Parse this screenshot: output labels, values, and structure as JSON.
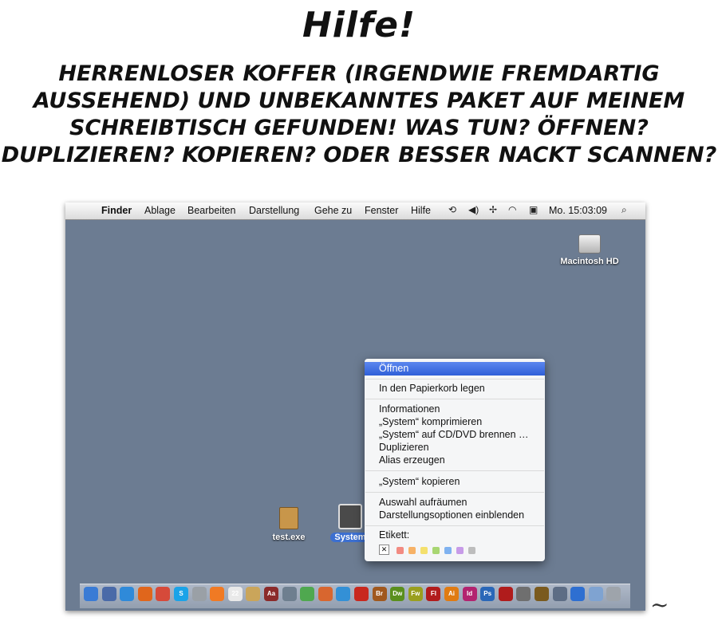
{
  "title": "Hilfe!",
  "message": [
    "Herrenloser KOFFER (irgendwie fremdartig",
    "aussehend) und unbekanntes PAKET auf meinem",
    "Schreibtisch gefunden! Was tun? öffnen?",
    "Duplizieren? Kopieren? Oder besser nackt scannen?"
  ],
  "menubar": {
    "apple_icon": "",
    "items": [
      "Finder",
      "Ablage",
      "Bearbeiten",
      "Darstellung",
      "Gehe zu",
      "Fenster",
      "Hilfe"
    ],
    "status_icons": [
      "time-machine-icon",
      "volume-icon",
      "bluetooth-icon",
      "wifi-icon",
      "clock-icon"
    ],
    "clock": "Mo. 15:03:09",
    "search_icon": "magnifying-glass-icon"
  },
  "desktop": {
    "hd_label": "Macintosh HD",
    "exe_label": "test.exe",
    "system_label": "System"
  },
  "context_menu": {
    "open": "Öffnen",
    "trash": "In den Papierkorb legen",
    "info": "Informationen",
    "compress": "„System“ komprimieren",
    "burn": "„System“ auf CD/DVD brennen …",
    "duplicate": "Duplizieren",
    "alias": "Alias erzeugen",
    "copy": "„System“ kopieren",
    "cleanup": "Auswahl aufräumen",
    "view_options": "Darstellungsoptionen einblenden",
    "label_heading": "Etikett:",
    "label_none": "✕",
    "label_colors": [
      "#f28b82",
      "#f7b267",
      "#f4e06d",
      "#a8d672",
      "#7fb2f0",
      "#c79be8",
      "#bdbdbd"
    ]
  },
  "dock": {
    "apps": [
      {
        "name": "finder-icon",
        "label": "",
        "color": "#3a7bd5"
      },
      {
        "name": "preview-icon",
        "label": "",
        "color": "#4a6aa8"
      },
      {
        "name": "safari-icon",
        "label": "",
        "color": "#2f8ad9"
      },
      {
        "name": "firefox-icon",
        "label": "",
        "color": "#e0661c"
      },
      {
        "name": "chrome-icon",
        "label": "",
        "color": "#d64a3a"
      },
      {
        "name": "skype-icon",
        "label": "S",
        "color": "#1aa3e8"
      },
      {
        "name": "support-icon",
        "label": "",
        "color": "#9aa0a6"
      },
      {
        "name": "xampp-icon",
        "label": "",
        "color": "#f07a24"
      },
      {
        "name": "calendar-icon",
        "label": "22",
        "color": "#e9e9e9"
      },
      {
        "name": "pages-icon",
        "label": "",
        "color": "#caa55a"
      },
      {
        "name": "dictionary-icon",
        "label": "Aa",
        "color": "#8b2a2a"
      },
      {
        "name": "script-icon",
        "label": "",
        "color": "#6e7f8f"
      },
      {
        "name": "chart-app-icon",
        "label": "",
        "color": "#4fa84f"
      },
      {
        "name": "keynote-icon",
        "label": "",
        "color": "#d8662f"
      },
      {
        "name": "network-icon",
        "label": "",
        "color": "#3390d6"
      },
      {
        "name": "acrobat-icon",
        "label": "",
        "color": "#c8281e"
      },
      {
        "name": "bridge-icon",
        "label": "Br",
        "color": "#a0581e"
      },
      {
        "name": "dreamweaver-icon",
        "label": "Dw",
        "color": "#5a8f1d"
      },
      {
        "name": "fireworks-icon",
        "label": "Fw",
        "color": "#9a9f1e"
      },
      {
        "name": "flash-icon",
        "label": "Fl",
        "color": "#b21c1c"
      },
      {
        "name": "illustrator-icon",
        "label": "Ai",
        "color": "#e07b12"
      },
      {
        "name": "indesign-icon",
        "label": "Id",
        "color": "#b3236f"
      },
      {
        "name": "photoshop-icon",
        "label": "Ps",
        "color": "#2a67b8"
      },
      {
        "name": "book-icon",
        "label": "",
        "color": "#b01c1c"
      },
      {
        "name": "settings-icon",
        "label": "",
        "color": "#6f6f6f"
      },
      {
        "name": "globe-icon",
        "label": "",
        "color": "#7a5a1e"
      },
      {
        "name": "mail-icon",
        "label": "",
        "color": "#5d6d85"
      },
      {
        "name": "home-icon",
        "label": "",
        "color": "#2e6fd1"
      },
      {
        "name": "folder-icon",
        "label": "",
        "color": "#7fa3d1"
      },
      {
        "name": "trash-icon",
        "label": "",
        "color": "#9ea4ab"
      }
    ]
  },
  "signature_name": "signature-mark"
}
